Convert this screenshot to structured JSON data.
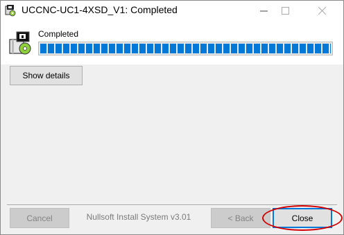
{
  "window": {
    "title": "UCCNC-UC1-4XSD_V1: Completed",
    "icon": "installer-icon",
    "controls": [
      "minimize-icon",
      "maximize-icon",
      "close-icon"
    ]
  },
  "header": {
    "status": "Completed",
    "progress_percent": 100,
    "progress_color": "#0078d7",
    "icon": "package-disc-icon"
  },
  "body": {
    "show_details_label": "Show details"
  },
  "footer": {
    "cancel_label": "Cancel",
    "branding": "Nullsoft Install System v3.01",
    "back_label": "< Back",
    "close_label": "Close"
  },
  "annotation": {
    "highlight_color": "#d40000",
    "highlighted": "close-button"
  }
}
